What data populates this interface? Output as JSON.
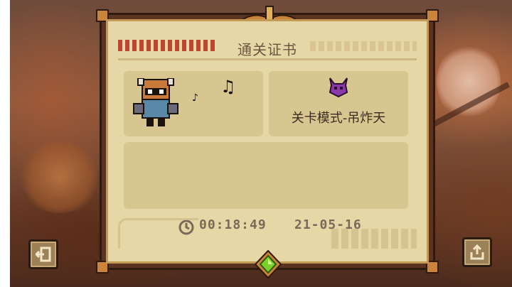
{
  "certificate": {
    "title": "通关证书",
    "level_name": "关卡模式-吊炸天",
    "clear_time": "00:18:49",
    "date": "21-05-16"
  },
  "music_notes": [
    "♪",
    "♫"
  ],
  "icons": {
    "character": "horned-knight-character-icon",
    "boss": "horned-demon-helmet-icon",
    "clock": "clock-icon",
    "gem": "green-gem-icon",
    "exit": "exit-door-icon",
    "share": "share-upload-icon"
  },
  "colors": {
    "parchment": "#e6d7a6",
    "panel": "#d8c690",
    "frame": "#5a3420",
    "boss_purple": "#8a3aa8",
    "gem_green": "#7bd12a"
  }
}
